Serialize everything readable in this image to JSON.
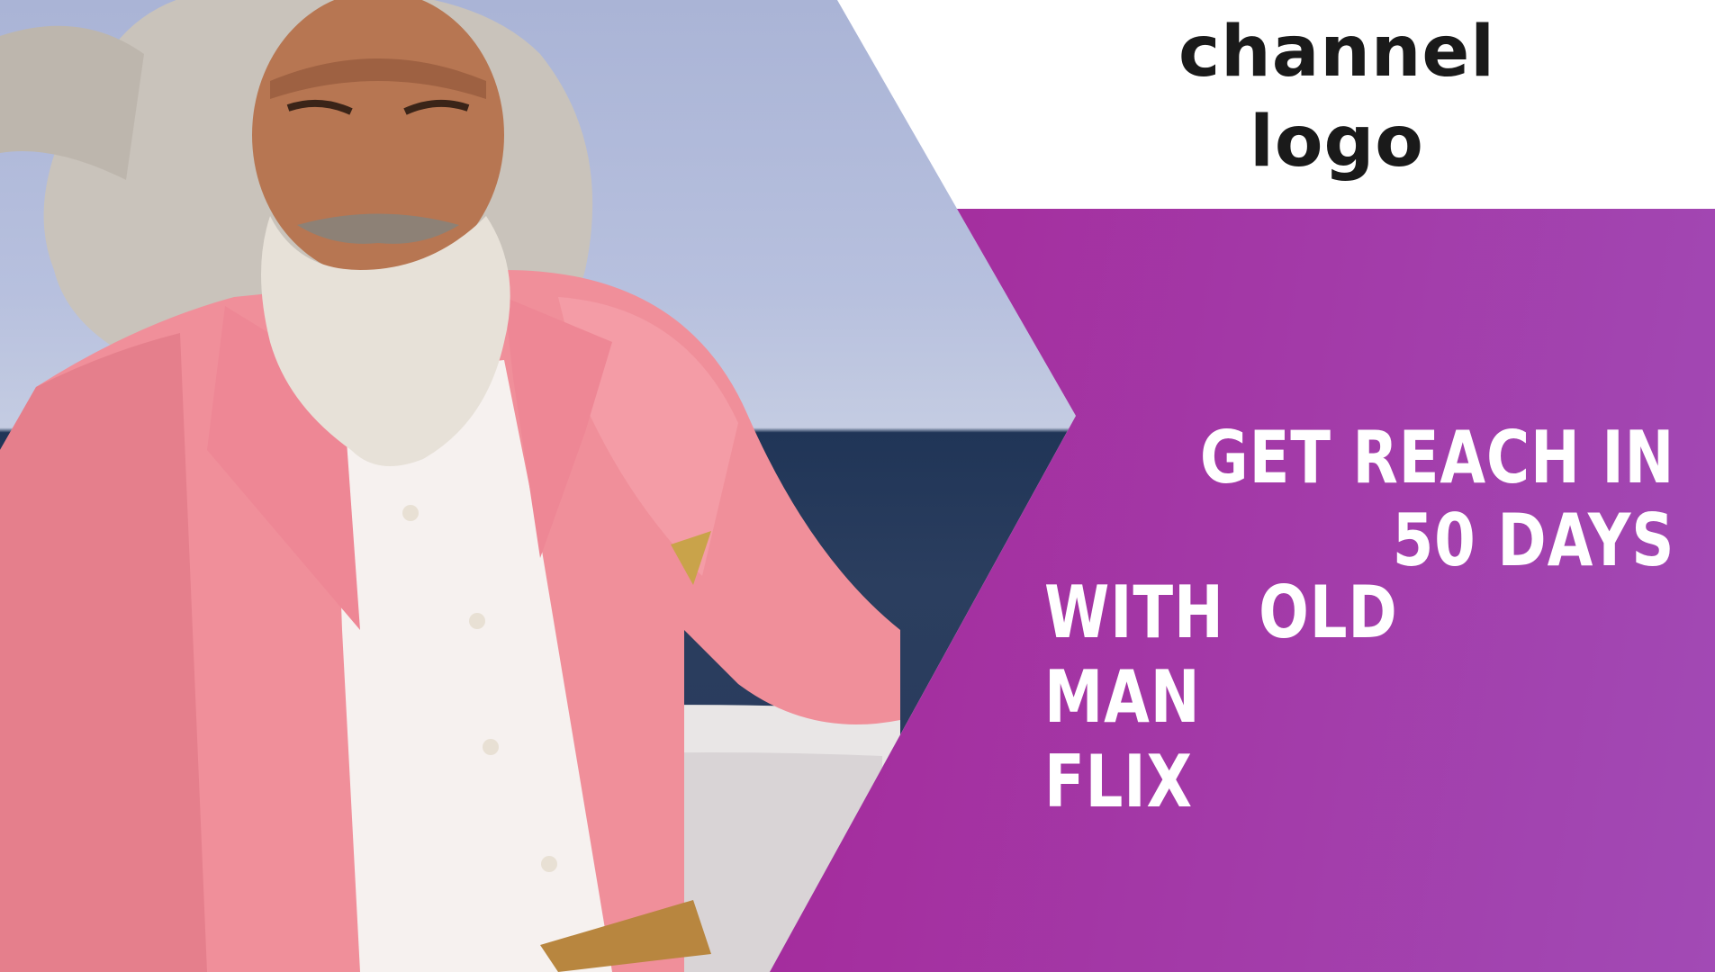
{
  "logo": {
    "line1": "channel",
    "line2": "logo"
  },
  "headline": {
    "line1": "GET REACH IN",
    "line2": "50 DAYS",
    "line3": "WITH OLD MAN",
    "line4": "FLIX"
  },
  "colors": {
    "panel_start": "#a0168d",
    "panel_end": "#a24ab5",
    "suit_pink": "#f08f9a",
    "sky": "#b7c0de",
    "sea": "#27395a",
    "logo_text": "#1a1a1a",
    "headline_text": "#ffffff"
  }
}
